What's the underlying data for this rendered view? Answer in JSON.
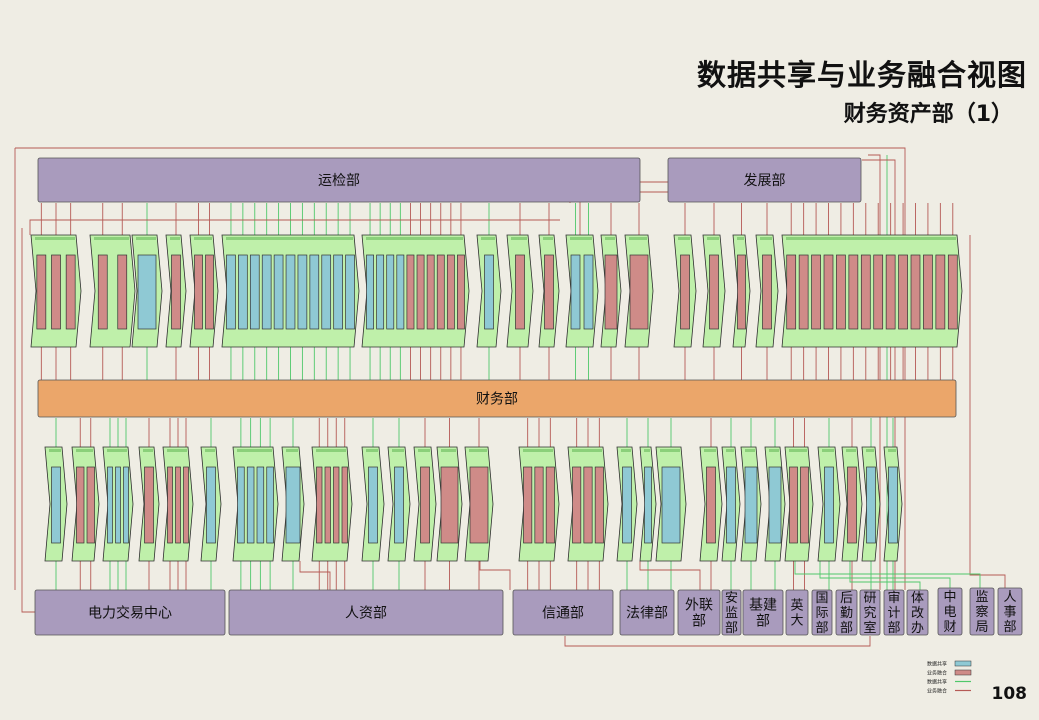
{
  "title": "数据共享与业务融合视图",
  "subtitle": "财务资产部（1）",
  "page_number": "108",
  "colors": {
    "department_box": "#a99bbd",
    "finance_bar": "#eba66a",
    "module_fill": "#bff0aa",
    "data_share": "#8fc9d4",
    "business_fusion": "#cf8b88",
    "share_line": "#4fc86a",
    "fusion_line": "#b55a55"
  },
  "departments": {
    "top": [
      {
        "id": "yunjian",
        "label": "运检部"
      },
      {
        "id": "fazhan",
        "label": "发展部"
      }
    ],
    "finance": {
      "id": "caiwu",
      "label": "财务部"
    },
    "bottom": [
      {
        "id": "dianli",
        "label": "电力交易中心"
      },
      {
        "id": "renzi",
        "label": "人资部"
      },
      {
        "id": "xintong",
        "label": "信通部"
      },
      {
        "id": "falv",
        "label": "法律部"
      },
      {
        "id": "wailian",
        "label": "外联\n部"
      },
      {
        "id": "anjian",
        "label": "安\n监\n部"
      },
      {
        "id": "jijian",
        "label": "基建\n部"
      },
      {
        "id": "yingda",
        "label": "英\n大"
      },
      {
        "id": "guoji",
        "label": "国\n际\n部"
      },
      {
        "id": "houqin",
        "label": "后\n勤\n部"
      },
      {
        "id": "yanjiu",
        "label": "研\n究\n室"
      },
      {
        "id": "shenji",
        "label": "审\n计\n部"
      },
      {
        "id": "tigai",
        "label": "体\n改\n办"
      },
      {
        "id": "zhongdian",
        "label": "中\n电\n财"
      },
      {
        "id": "jiancha",
        "label": "监\n察\n局"
      },
      {
        "id": "renshi",
        "label": "人\n事\n部"
      }
    ]
  },
  "legend": [
    {
      "label": "数据共享",
      "type": "box",
      "color": "#8fc9d4"
    },
    {
      "label": "业务融合",
      "type": "box",
      "color": "#cf8b88"
    },
    {
      "label": "数据共享",
      "type": "line",
      "color": "#4fc86a"
    },
    {
      "label": "业务融合",
      "type": "line",
      "color": "#b55a55"
    }
  ]
}
